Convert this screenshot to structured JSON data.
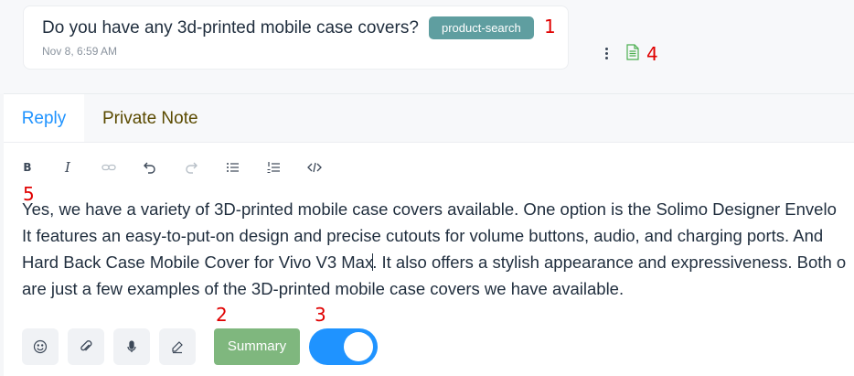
{
  "message": {
    "text": "Do you have any 3d-printed mobile case covers?",
    "tag": "product-search",
    "timestamp": "Nov 8, 6:59 AM",
    "more_icon": "kebab-vertical-icon",
    "transcript_icon": "document-icon"
  },
  "annotations": [
    "1",
    "2",
    "3",
    "4",
    "5"
  ],
  "editor": {
    "tabs": [
      {
        "label": "Reply",
        "active": true
      },
      {
        "label": "Private Note",
        "active": false
      }
    ],
    "toolbar": [
      {
        "name": "bold",
        "glyph": "B"
      },
      {
        "name": "italic",
        "glyph": "I"
      },
      {
        "name": "link",
        "disabled": true
      },
      {
        "name": "undo"
      },
      {
        "name": "redo",
        "disabled": true
      },
      {
        "name": "bullet-list"
      },
      {
        "name": "numbered-list"
      },
      {
        "name": "code"
      }
    ],
    "reply_lines": [
      "Yes, we have a variety of 3D-printed mobile case covers available. One option is the Solimo Designer Envelo",
      "It features an easy-to-put-on design and precise cutouts for volume buttons, audio, and charging ports. And",
      "Hard Back Case Mobile Cover for Vivo V3 Max",
      ". It also offers a stylish appearance and expressiveness. Both o",
      "are just a few examples of the 3D-printed mobile case covers we have available."
    ]
  },
  "footer": {
    "summary_label": "Summary",
    "toggle_on": true,
    "icons": [
      "emoji-icon",
      "attachment-icon",
      "microphone-icon",
      "signature-icon"
    ]
  },
  "colors": {
    "accent": "#1f93ff",
    "tag_bg": "#5f9ea0",
    "summary_bg": "#7fb77e",
    "annotation": "#e00000",
    "private_note": "#5a4a00"
  }
}
